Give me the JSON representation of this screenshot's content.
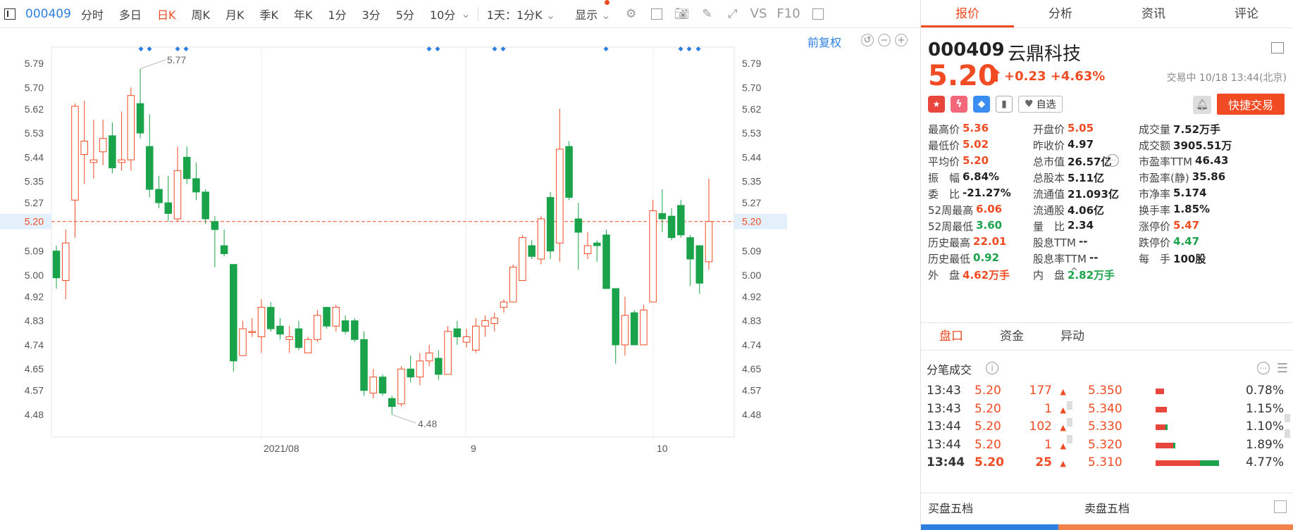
{
  "toolbar": {
    "code": "000409",
    "periods": [
      "分时",
      "多日",
      "日K",
      "周K",
      "月K",
      "季K",
      "年K",
      "1分",
      "3分",
      "5分",
      "10分"
    ],
    "active_period": "日K",
    "more_period": "1天：1分K",
    "display_label": "显示",
    "vs_label": "VS",
    "f10_label": "F10"
  },
  "chart": {
    "fuquan_label": "前复权",
    "y_ticks": [
      "5.79",
      "5.70",
      "5.62",
      "5.53",
      "5.44",
      "5.35",
      "5.27",
      "5.20",
      "5.09",
      "5.00",
      "4.92",
      "4.83",
      "4.74",
      "4.65",
      "4.57",
      "4.48"
    ],
    "x_labels": [
      "2021/08",
      "9",
      "10"
    ],
    "current_price_label": "5.20",
    "max_label": "5.77",
    "min_label": "4.48",
    "colors": {
      "up": "#f04b23",
      "down": "#1aa34a",
      "marker": "#2d7fe0"
    }
  },
  "chart_data": {
    "type": "candlestick",
    "title": "",
    "ylim": [
      4.45,
      5.82
    ],
    "x_tick_labels": [
      "2021/08",
      "9",
      "10"
    ],
    "candles": [
      {
        "o": 5.09,
        "h": 5.11,
        "l": 4.95,
        "c": 4.99
      },
      {
        "o": 4.98,
        "h": 5.17,
        "l": 4.91,
        "c": 5.12
      },
      {
        "o": 5.28,
        "h": 5.64,
        "l": 5.14,
        "c": 5.63
      },
      {
        "o": 5.45,
        "h": 5.65,
        "l": 5.34,
        "c": 5.5
      },
      {
        "o": 5.42,
        "h": 5.58,
        "l": 5.36,
        "c": 5.43
      },
      {
        "o": 5.46,
        "h": 5.58,
        "l": 5.41,
        "c": 5.51
      },
      {
        "o": 5.52,
        "h": 5.57,
        "l": 5.38,
        "c": 5.4
      },
      {
        "o": 5.42,
        "h": 5.61,
        "l": 5.39,
        "c": 5.43
      },
      {
        "o": 5.43,
        "h": 5.7,
        "l": 5.39,
        "c": 5.67
      },
      {
        "o": 5.64,
        "h": 5.77,
        "l": 5.51,
        "c": 5.53
      },
      {
        "o": 5.48,
        "h": 5.6,
        "l": 5.29,
        "c": 5.32
      },
      {
        "o": 5.32,
        "h": 5.37,
        "l": 5.25,
        "c": 5.27
      },
      {
        "o": 5.27,
        "h": 5.37,
        "l": 5.2,
        "c": 5.23
      },
      {
        "o": 5.21,
        "h": 5.48,
        "l": 5.2,
        "c": 5.39
      },
      {
        "o": 5.44,
        "h": 5.48,
        "l": 5.34,
        "c": 5.36
      },
      {
        "o": 5.36,
        "h": 5.42,
        "l": 5.28,
        "c": 5.31
      },
      {
        "o": 5.31,
        "h": 5.32,
        "l": 5.19,
        "c": 5.21
      },
      {
        "o": 5.2,
        "h": 5.22,
        "l": 5.03,
        "c": 5.17
      },
      {
        "o": 5.11,
        "h": 5.17,
        "l": 5.07,
        "c": 5.08
      },
      {
        "o": 5.04,
        "h": 5.04,
        "l": 4.64,
        "c": 4.68
      },
      {
        "o": 4.7,
        "h": 4.83,
        "l": 4.7,
        "c": 4.8
      },
      {
        "o": 4.79,
        "h": 4.84,
        "l": 4.77,
        "c": 4.79
      },
      {
        "o": 4.77,
        "h": 4.91,
        "l": 4.71,
        "c": 4.88
      },
      {
        "o": 4.88,
        "h": 4.9,
        "l": 4.79,
        "c": 4.8
      },
      {
        "o": 4.81,
        "h": 4.84,
        "l": 4.76,
        "c": 4.78
      },
      {
        "o": 4.76,
        "h": 4.81,
        "l": 4.71,
        "c": 4.77
      },
      {
        "o": 4.8,
        "h": 4.83,
        "l": 4.72,
        "c": 4.73
      },
      {
        "o": 4.71,
        "h": 4.77,
        "l": 4.71,
        "c": 4.76
      },
      {
        "o": 4.76,
        "h": 4.87,
        "l": 4.75,
        "c": 4.85
      },
      {
        "o": 4.88,
        "h": 4.88,
        "l": 4.8,
        "c": 4.81
      },
      {
        "o": 4.81,
        "h": 4.89,
        "l": 4.79,
        "c": 4.88
      },
      {
        "o": 4.83,
        "h": 4.85,
        "l": 4.78,
        "c": 4.79
      },
      {
        "o": 4.83,
        "h": 4.84,
        "l": 4.75,
        "c": 4.76
      },
      {
        "o": 4.76,
        "h": 4.79,
        "l": 4.55,
        "c": 4.57
      },
      {
        "o": 4.56,
        "h": 4.65,
        "l": 4.54,
        "c": 4.62
      },
      {
        "o": 4.62,
        "h": 4.63,
        "l": 4.55,
        "c": 4.56
      },
      {
        "o": 4.54,
        "h": 4.55,
        "l": 4.48,
        "c": 4.51
      },
      {
        "o": 4.52,
        "h": 4.66,
        "l": 4.51,
        "c": 4.65
      },
      {
        "o": 4.65,
        "h": 4.7,
        "l": 4.6,
        "c": 4.62
      },
      {
        "o": 4.62,
        "h": 4.71,
        "l": 4.59,
        "c": 4.68
      },
      {
        "o": 4.68,
        "h": 4.74,
        "l": 4.66,
        "c": 4.71
      },
      {
        "o": 4.69,
        "h": 4.72,
        "l": 4.61,
        "c": 4.63
      },
      {
        "o": 4.63,
        "h": 4.81,
        "l": 4.63,
        "c": 4.79
      },
      {
        "o": 4.8,
        "h": 4.83,
        "l": 4.74,
        "c": 4.77
      },
      {
        "o": 4.75,
        "h": 4.8,
        "l": 4.73,
        "c": 4.77
      },
      {
        "o": 4.72,
        "h": 4.84,
        "l": 4.71,
        "c": 4.81
      },
      {
        "o": 4.81,
        "h": 4.85,
        "l": 4.77,
        "c": 4.83
      },
      {
        "o": 4.82,
        "h": 4.86,
        "l": 4.79,
        "c": 4.84
      },
      {
        "o": 4.88,
        "h": 4.91,
        "l": 4.86,
        "c": 4.9
      },
      {
        "o": 4.9,
        "h": 5.04,
        "l": 4.9,
        "c": 5.03
      },
      {
        "o": 4.98,
        "h": 5.15,
        "l": 4.98,
        "c": 5.14
      },
      {
        "o": 5.11,
        "h": 5.13,
        "l": 5.06,
        "c": 5.07
      },
      {
        "o": 5.06,
        "h": 5.22,
        "l": 5.04,
        "c": 5.21
      },
      {
        "o": 5.29,
        "h": 5.31,
        "l": 5.06,
        "c": 5.09
      },
      {
        "o": 5.12,
        "h": 5.62,
        "l": 5.05,
        "c": 5.47
      },
      {
        "o": 5.48,
        "h": 5.5,
        "l": 5.28,
        "c": 5.29
      },
      {
        "o": 5.21,
        "h": 5.27,
        "l": 5.02,
        "c": 5.16
      },
      {
        "o": 5.08,
        "h": 5.16,
        "l": 5.06,
        "c": 5.11
      },
      {
        "o": 5.12,
        "h": 5.13,
        "l": 5.05,
        "c": 5.11
      },
      {
        "o": 5.15,
        "h": 5.17,
        "l": 4.95,
        "c": 4.95
      },
      {
        "o": 4.95,
        "h": 4.95,
        "l": 4.67,
        "c": 4.74
      },
      {
        "o": 4.74,
        "h": 4.92,
        "l": 4.7,
        "c": 4.85
      },
      {
        "o": 4.86,
        "h": 4.87,
        "l": 4.74,
        "c": 4.74
      },
      {
        "o": 4.74,
        "h": 4.89,
        "l": 4.74,
        "c": 4.87
      },
      {
        "o": 4.9,
        "h": 5.28,
        "l": 4.9,
        "c": 5.24
      },
      {
        "o": 5.23,
        "h": 5.32,
        "l": 5.16,
        "c": 5.21
      },
      {
        "o": 5.22,
        "h": 5.25,
        "l": 5.13,
        "c": 5.14
      },
      {
        "o": 5.26,
        "h": 5.28,
        "l": 5.14,
        "c": 5.15
      },
      {
        "o": 5.14,
        "h": 5.15,
        "l": 4.96,
        "c": 5.06
      },
      {
        "o": 5.11,
        "h": 5.11,
        "l": 4.93,
        "c": 4.97
      },
      {
        "o": 5.05,
        "h": 5.36,
        "l": 5.02,
        "c": 5.2
      }
    ]
  },
  "panel": {
    "tabs": [
      "报价",
      "分析",
      "资讯",
      "评论"
    ],
    "active_tab": "报价",
    "code": "000409",
    "name": "云鼎科技",
    "price": "5.20",
    "arrow": "⬆",
    "change": "+0.23",
    "change_pct": "+4.63%",
    "status": "交易中 10/18 13:44(北京)",
    "watch_label": "自选",
    "quick_trade": "快捷交易",
    "stats": [
      [
        {
          "label": "最高价",
          "value": "5.36",
          "cls": "r"
        },
        {
          "label": "开盘价",
          "value": "5.05",
          "cls": "r"
        },
        {
          "label": "成交量",
          "value": "7.52万手",
          "cls": ""
        }
      ],
      [
        {
          "label": "最低价",
          "value": "5.02",
          "cls": "r"
        },
        {
          "label": "昨收价",
          "value": "4.97",
          "cls": ""
        },
        {
          "label": "成交额",
          "value": "3905.51万",
          "cls": ""
        }
      ],
      [
        {
          "label": "平均价",
          "value": "5.20",
          "cls": "r"
        },
        {
          "label": "总市值",
          "value": "26.57亿",
          "cls": ""
        },
        {
          "label": "市盈率TTM",
          "value": "46.43",
          "cls": ""
        }
      ],
      [
        {
          "label": "振　幅",
          "value": "6.84%",
          "cls": ""
        },
        {
          "label": "总股本",
          "value": "5.11亿",
          "cls": ""
        },
        {
          "label": "市盈率(静)",
          "value": "35.86",
          "cls": ""
        }
      ],
      [
        {
          "label": "委　比",
          "value": "-21.27%",
          "cls": ""
        },
        {
          "label": "流通值",
          "value": "21.093亿",
          "cls": ""
        },
        {
          "label": "市净率",
          "value": "5.174",
          "cls": ""
        }
      ],
      [
        {
          "label": "52周最高",
          "value": "6.06",
          "cls": "r"
        },
        {
          "label": "流通股",
          "value": "4.06亿",
          "cls": ""
        },
        {
          "label": "换手率",
          "value": "1.85%",
          "cls": ""
        }
      ],
      [
        {
          "label": "52周最低",
          "value": "3.60",
          "cls": "g"
        },
        {
          "label": "量　比",
          "value": "2.34",
          "cls": ""
        },
        {
          "label": "涨停价",
          "value": "5.47",
          "cls": "r"
        }
      ],
      [
        {
          "label": "历史最高",
          "value": "22.01",
          "cls": "r"
        },
        {
          "label": "股息TTM",
          "value": "--",
          "cls": ""
        },
        {
          "label": "跌停价",
          "value": "4.47",
          "cls": "g"
        }
      ],
      [
        {
          "label": "历史最低",
          "value": "0.92",
          "cls": "g"
        },
        {
          "label": "股息率TTM",
          "value": "--",
          "cls": ""
        },
        {
          "label": "每　手",
          "value": "100股",
          "cls": ""
        }
      ],
      [
        {
          "label": "外　盘",
          "value": "4.62万手",
          "cls": "r"
        },
        {
          "label": "内　盘",
          "value": "2.82万手",
          "cls": "g"
        },
        {
          "label": "",
          "value": "",
          "cls": ""
        }
      ]
    ],
    "subtabs": [
      "盘口",
      "资金",
      "异动"
    ],
    "active_subtab": "盘口",
    "ticks_title": "分笔成交",
    "ticks": [
      {
        "time": "13:43",
        "price": "5.20",
        "vol": "177"
      },
      {
        "time": "13:43",
        "price": "5.20",
        "vol": "1"
      },
      {
        "time": "13:44",
        "price": "5.20",
        "vol": "102"
      },
      {
        "time": "13:44",
        "price": "5.20",
        "vol": "1"
      },
      {
        "time": "13:44",
        "price": "5.20",
        "vol": "25"
      }
    ],
    "ladder": [
      {
        "price": "5.350",
        "pct": "0.78%",
        "red": 0.12,
        "green": 0.0
      },
      {
        "price": "5.340",
        "pct": "1.15%",
        "red": 0.16,
        "green": 0.0
      },
      {
        "price": "5.330",
        "pct": "1.10%",
        "red": 0.14,
        "green": 0.03
      },
      {
        "price": "5.320",
        "pct": "1.89%",
        "red": 0.25,
        "green": 0.03
      },
      {
        "price": "5.310",
        "pct": "4.77%",
        "red": 0.63,
        "green": 0.27
      }
    ],
    "buy_five": "买盘五档",
    "sell_five": "卖盘五档"
  }
}
